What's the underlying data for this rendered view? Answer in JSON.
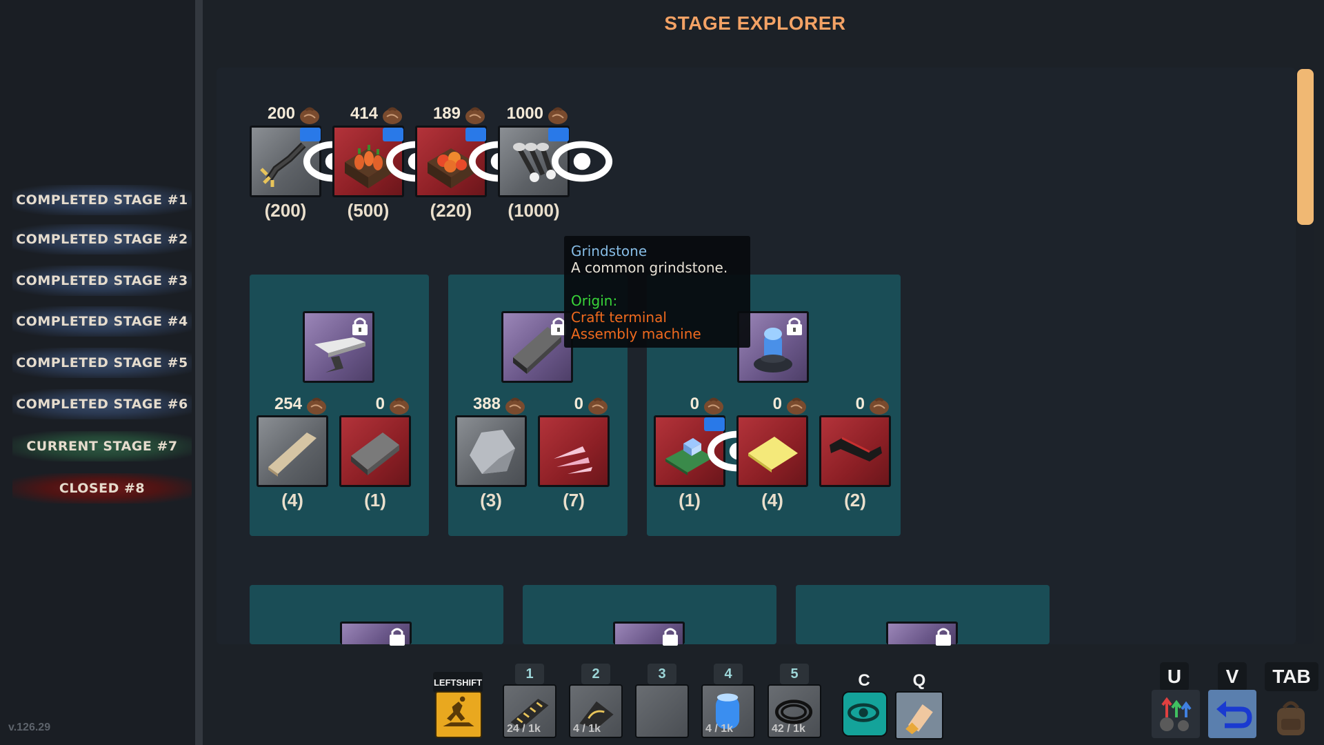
{
  "header": {
    "title": "STAGE EXPLORER"
  },
  "sidebar": {
    "stages": [
      {
        "label": "COMPLETED STAGE #1",
        "status": "completed"
      },
      {
        "label": "COMPLETED STAGE #2",
        "status": "completed"
      },
      {
        "label": "COMPLETED STAGE #3",
        "status": "completed"
      },
      {
        "label": "COMPLETED STAGE #4",
        "status": "completed"
      },
      {
        "label": "COMPLETED STAGE #5",
        "status": "completed"
      },
      {
        "label": "COMPLETED STAGE #6",
        "status": "completed"
      },
      {
        "label": "CURRENT STAGE #7",
        "status": "current"
      },
      {
        "label": "CLOSED #8",
        "status": "closed"
      }
    ],
    "version": "v.126.29"
  },
  "top_items": [
    {
      "icon": "mechanical-arm-icon",
      "count": "200",
      "required": "(200)"
    },
    {
      "icon": "carrot-crate-icon",
      "count": "414",
      "required": "(500)"
    },
    {
      "icon": "tomato-crate-icon",
      "count": "189",
      "required": "(220)"
    },
    {
      "icon": "hammers-icon",
      "count": "1000",
      "required": "(1000)"
    }
  ],
  "groups": [
    {
      "recipe_icon": "anvil-icon",
      "items": [
        {
          "icon": "wood-plank-icon",
          "count": "254",
          "required": "(4)"
        },
        {
          "icon": "iron-ingot-icon",
          "count": "0",
          "required": "(1)"
        }
      ]
    },
    {
      "recipe_icon": "grindstone-icon",
      "items": [
        {
          "icon": "stone-icon",
          "count": "388",
          "required": "(3)"
        },
        {
          "icon": "crystal-shards-icon",
          "count": "0",
          "required": "(7)"
        }
      ]
    },
    {
      "recipe_icon": "teleporter-icon",
      "items": [
        {
          "icon": "circuit-board-icon",
          "count": "0",
          "required": "(1)"
        },
        {
          "icon": "paper-sheets-icon",
          "count": "0",
          "required": "(4)"
        },
        {
          "icon": "cable-icon",
          "count": "0",
          "required": "(2)"
        }
      ]
    }
  ],
  "tooltip": {
    "name": "Grindstone",
    "description": "A common grindstone.",
    "origin_label": "Origin:",
    "sources": [
      "Craft terminal",
      "Assembly machine"
    ]
  },
  "hotbar": {
    "sprint_key": "LEFTSHIFT",
    "slots": [
      {
        "key": "1",
        "count": "24 / 1k",
        "icon": "rail-icon"
      },
      {
        "key": "2",
        "count": "4 / 1k",
        "icon": "rail-corner-icon"
      },
      {
        "key": "3",
        "count": "",
        "icon": "empty-slot"
      },
      {
        "key": "4",
        "count": "4 / 1k",
        "icon": "blue-tank-icon"
      },
      {
        "key": "5",
        "count": "42 / 1k",
        "icon": "cable-coil-icon"
      }
    ],
    "view_key": "C",
    "grab_key": "Q",
    "upgrades_key": "U",
    "undo_key": "V",
    "inventory_key": "TAB"
  },
  "colors": {
    "accent": "#f3a265",
    "panel": "#1d232b",
    "group": "#1a4d56",
    "eye_badge": "#2979e8",
    "tooltip_origin": "#39d639",
    "tooltip_source": "#f06a1e"
  }
}
